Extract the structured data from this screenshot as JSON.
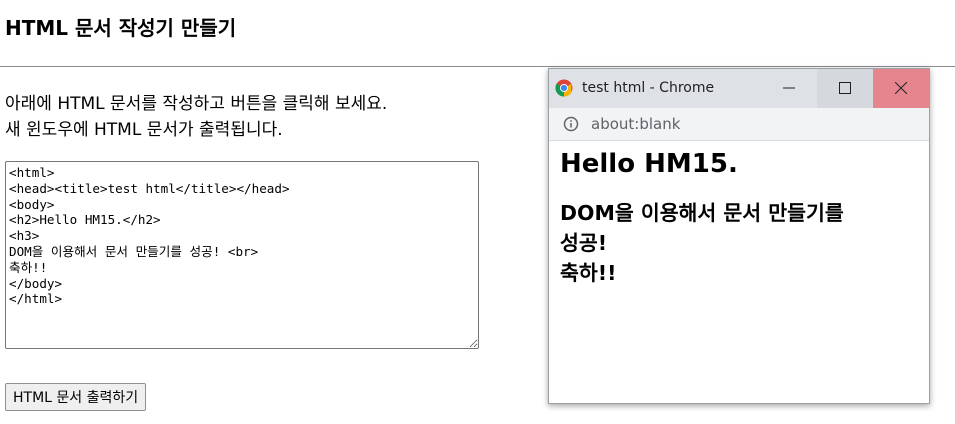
{
  "page": {
    "title": "HTML 문서 작성기 만들기",
    "intro_line1": "아래에 HTML 문서를 작성하고 버튼을 클릭해 보세요.",
    "intro_line2": "새 윈도우에 HTML 문서가 출력됩니다.",
    "editor_value": "<html>\n<head><title>test html</title></head>\n<body>\n<h2>Hello HM15.</h2>\n<h3>\nDOM을 이용해서 문서 만들기를 성공! <br>\n축하!!\n</body>\n</html>",
    "print_button_label": "HTML 문서 출력하기"
  },
  "popup": {
    "window_title": "test html - Chrome",
    "url": "about:blank",
    "heading": "Hello HM15.",
    "subheading_line1": "DOM을 이용해서 문서 만들기를",
    "subheading_line2": "성공!",
    "subheading_line3": "축하!!"
  },
  "icons": {
    "browser": "chrome-icon",
    "info": "info-icon",
    "minimize": "minimize-icon",
    "maximize": "maximize-icon",
    "close": "close-icon"
  },
  "colors": {
    "titlebar": "#dee1e6",
    "close_button": "#e5868f",
    "addressbar": "#f1f3f4"
  }
}
